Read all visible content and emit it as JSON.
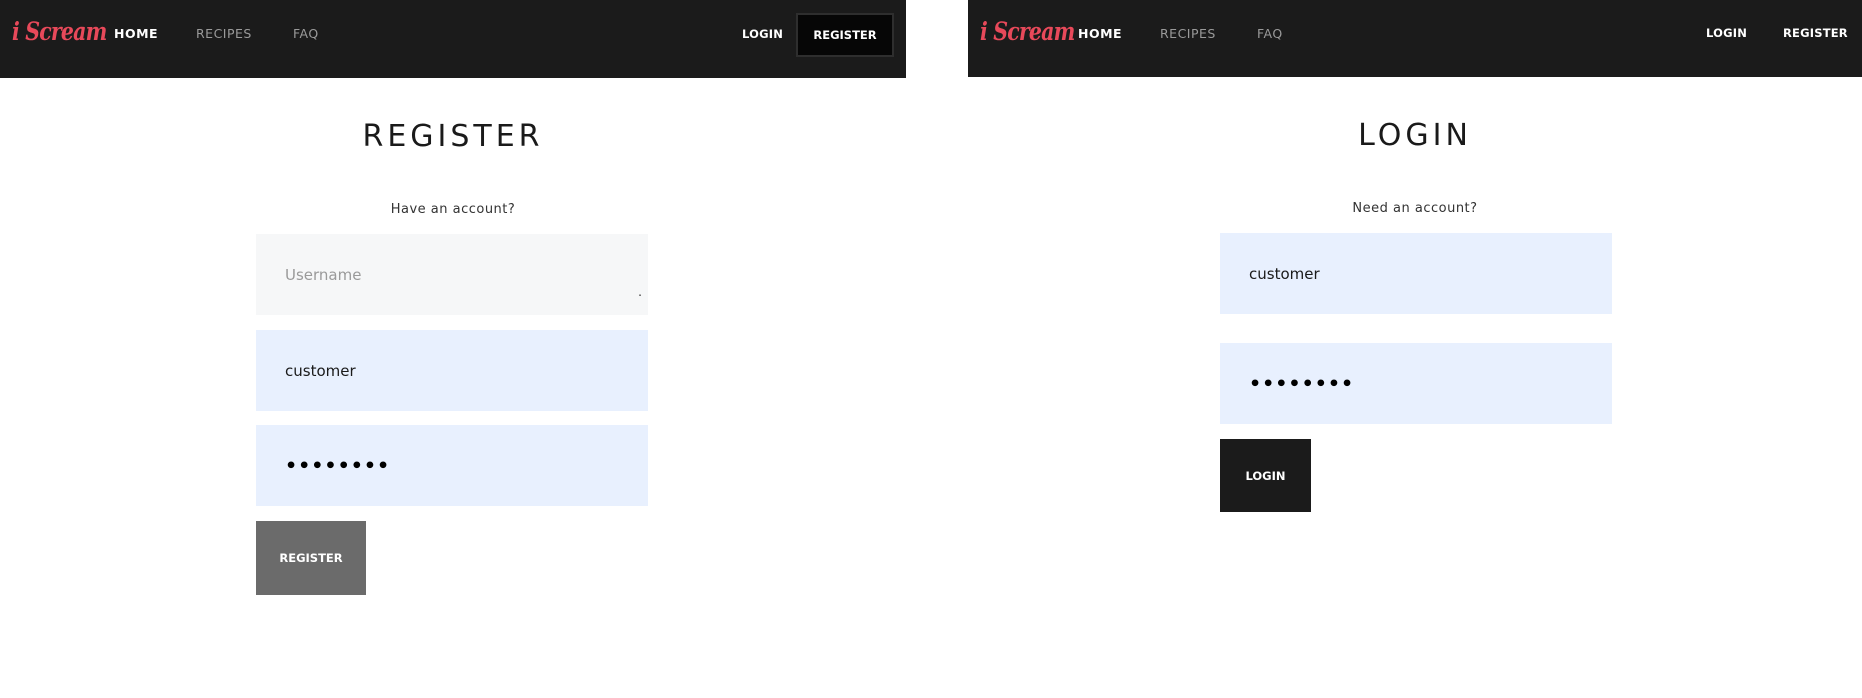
{
  "left": {
    "logo": "i Scream",
    "nav": {
      "home": "HOME",
      "recipes": "RECIPES",
      "faq": "FAQ",
      "login": "LOGIN",
      "register": "REGISTER"
    },
    "title": "REGISTER",
    "switch_link": "Have an account?",
    "fields": {
      "username_placeholder": "Username",
      "email_value": "customer",
      "password_value": "••••••••"
    },
    "submit_label": "REGISTER"
  },
  "right": {
    "logo": "i Scream",
    "nav": {
      "home": "HOME",
      "recipes": "RECIPES",
      "faq": "FAQ",
      "login": "LOGIN",
      "register": "REGISTER"
    },
    "title": "LOGIN",
    "switch_link": "Need an account?",
    "fields": {
      "username_value": "customer",
      "password_value": "••••••••"
    },
    "submit_label": "LOGIN"
  },
  "colors": {
    "navbar": "#1b1b1b",
    "brand": "#e8495a",
    "filled_input": "#e8f0fe",
    "empty_input": "#f6f7f8",
    "disabled_button": "#6b6b6b"
  }
}
